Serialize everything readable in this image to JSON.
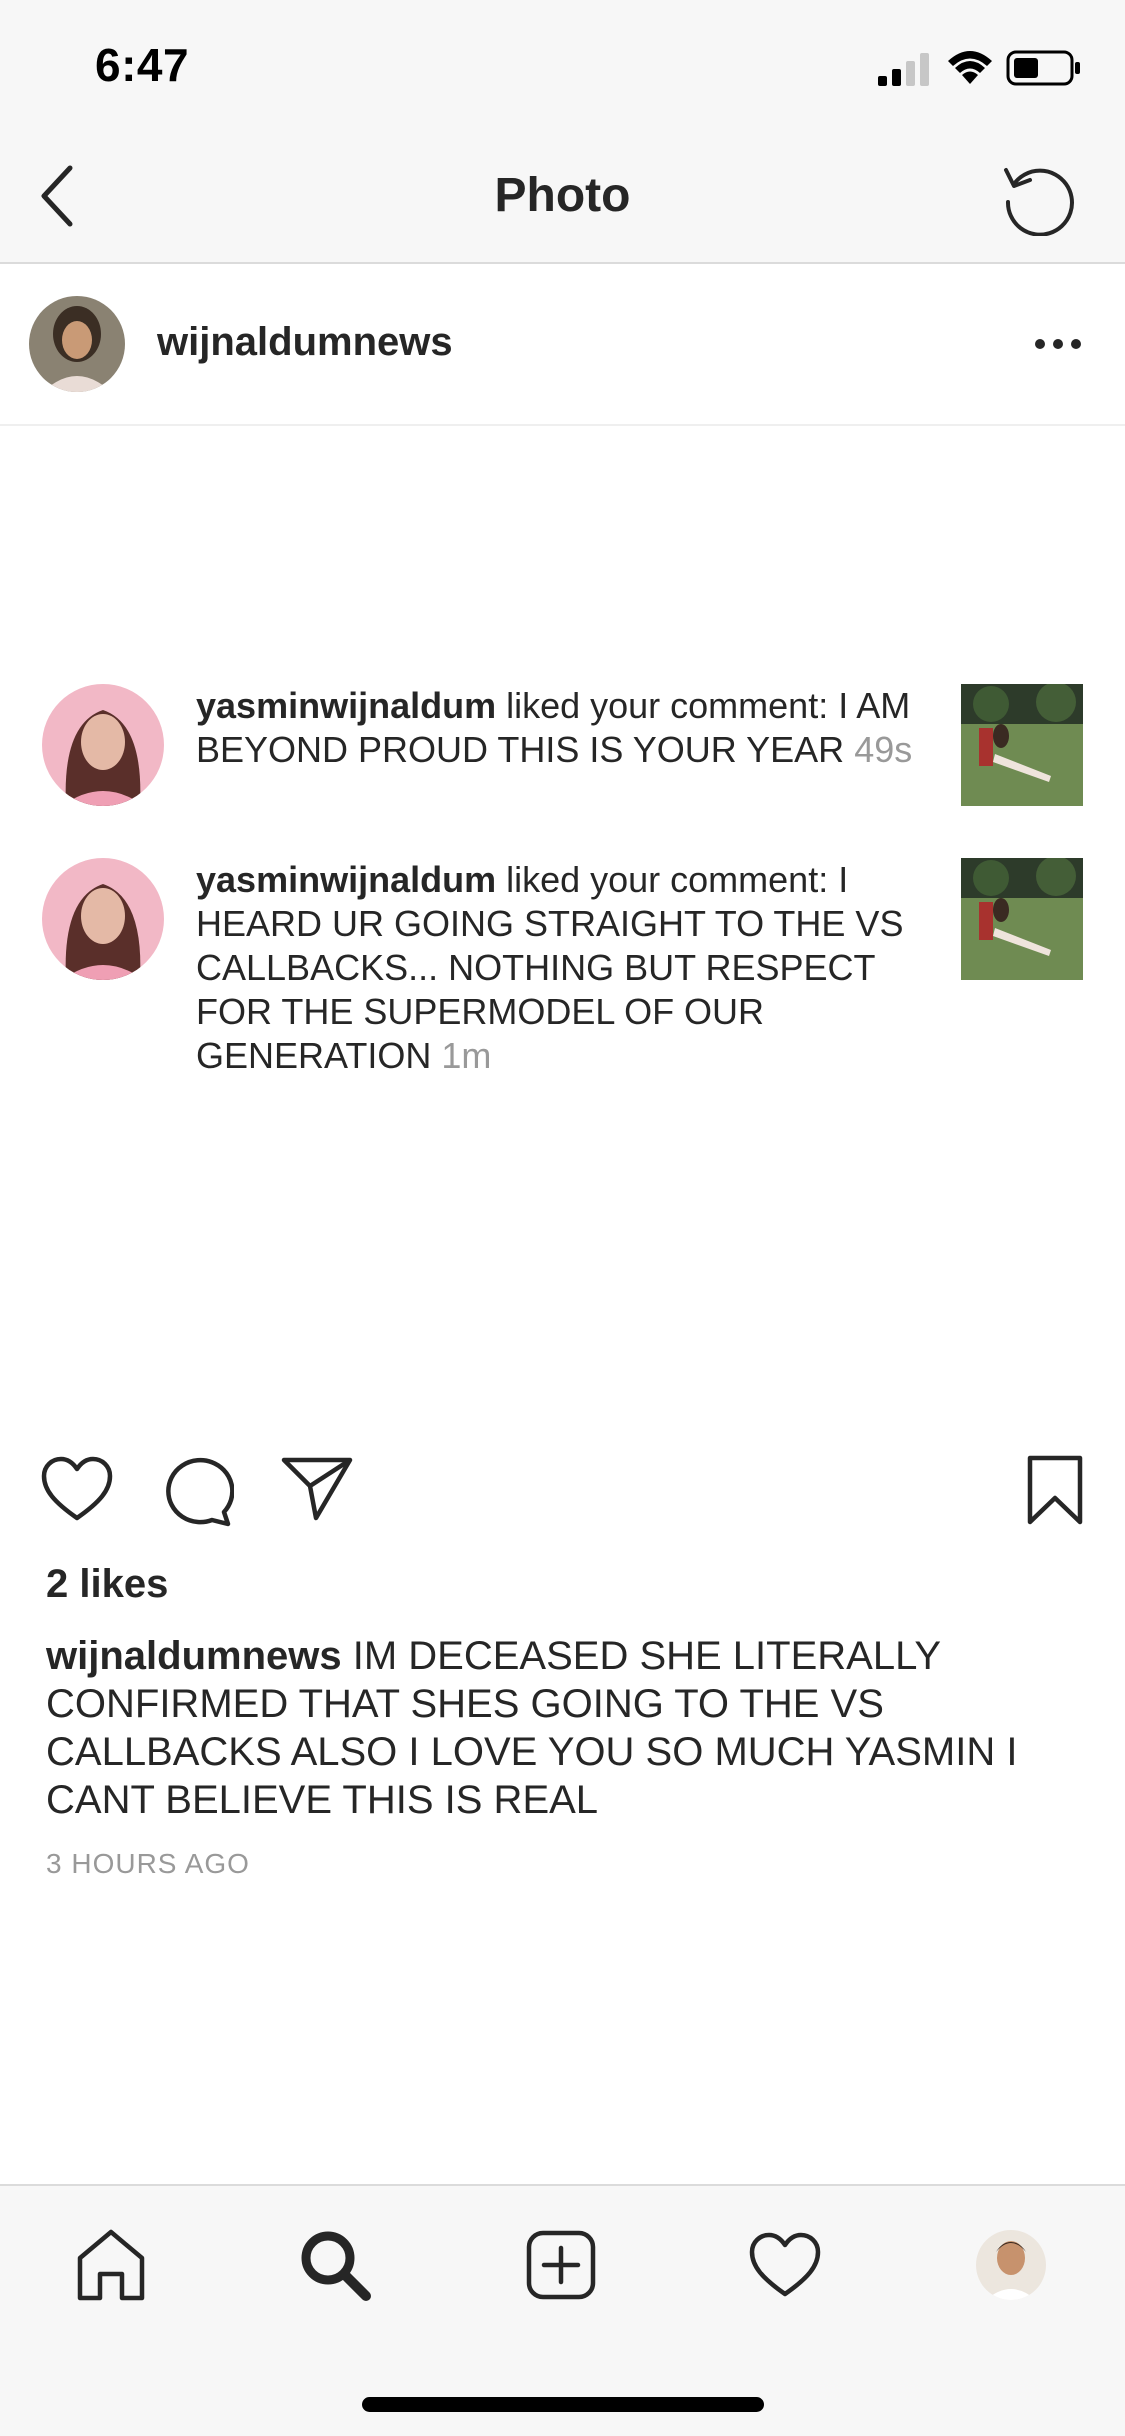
{
  "status_bar": {
    "time": "6:47"
  },
  "nav": {
    "title": "Photo"
  },
  "post": {
    "username": "wijnaldumnews",
    "notifications": [
      {
        "username": "yasminwijnaldum",
        "text": " liked your comment: I AM BEYOND PROUD THIS IS YOUR YEAR",
        "time": "49s"
      },
      {
        "username": "yasminwijnaldum",
        "text": " liked your comment: I HEARD UR GOING STRAIGHT TO THE VS CALLBACKS... NOTHING BUT RESPECT FOR THE SUPERMODEL OF OUR GENERATION",
        "time": "1m"
      }
    ],
    "likes": "2 likes",
    "caption_username": "wijnaldumnews",
    "caption_text": " IM DECEASED SHE LITERALLY CONFIRMED THAT SHES GOING TO THE VS CALLBACKS ALSO I LOVE YOU SO MUCH YASMIN I CANT BELIEVE THIS IS REAL",
    "posted": "3 HOURS AGO"
  },
  "icons": {
    "back": "chevron-left-icon",
    "refresh": "refresh-icon",
    "more": "more-icon",
    "like": "heart-icon",
    "comment": "comment-icon",
    "share": "send-icon",
    "save": "bookmark-icon",
    "tab_home": "home-icon",
    "tab_search": "search-icon",
    "tab_add": "add-icon",
    "tab_activity": "heart-icon",
    "tab_profile": "avatar"
  },
  "colors": {
    "text": "#262626",
    "muted": "#999999",
    "bar": "#f7f7f7",
    "divider": "#dbdbdb"
  }
}
